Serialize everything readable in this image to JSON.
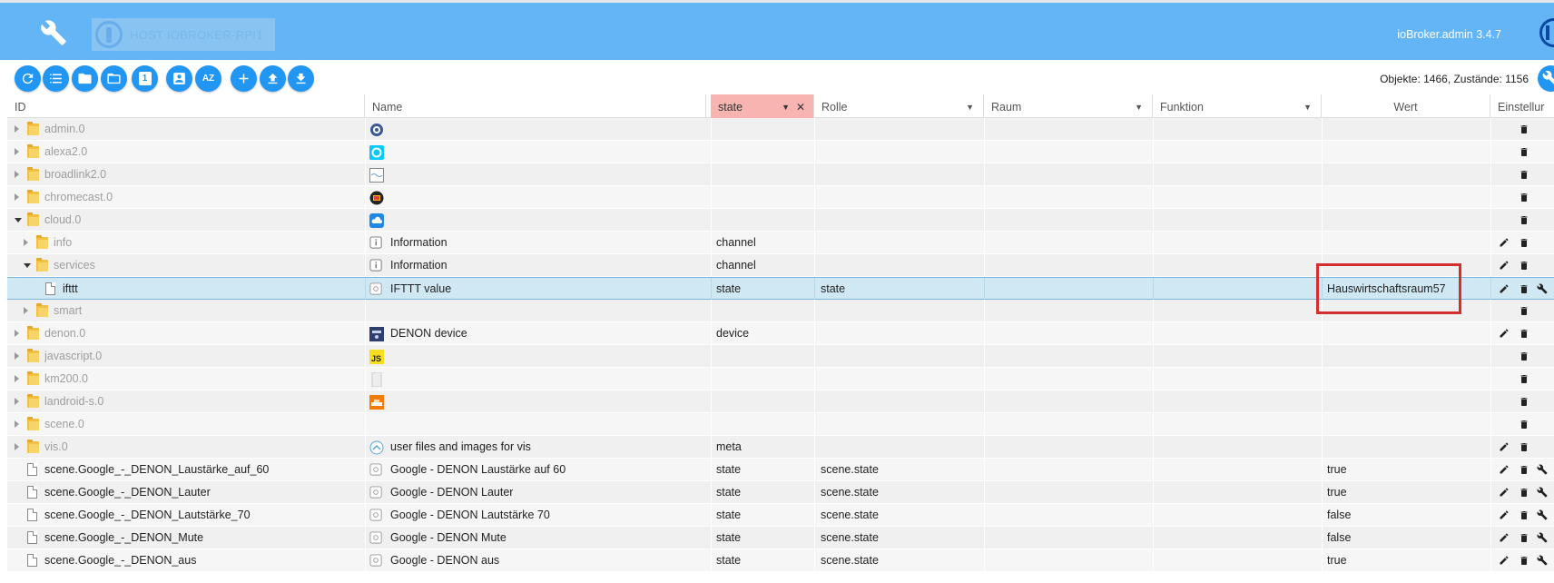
{
  "header": {
    "host_label": "HOST IOBROKER-RPI1",
    "version": "ioBroker.admin 3.4.7",
    "brand_color": "#64b5f6"
  },
  "toolbar": {
    "buttons": [
      "refresh-icon",
      "list-icon",
      "folder-icon",
      "folder-open-icon",
      "number-one-icon",
      "person-icon",
      "sort-az-icon",
      "plus-icon",
      "upload-icon",
      "download-icon"
    ],
    "sort_label": "AZ",
    "num_label": "1",
    "counts": "Objekte: 1466, Zustände: 1156"
  },
  "columns": {
    "id": "ID",
    "name": "Name",
    "type": "state",
    "role": "Rolle",
    "room": "Raum",
    "function": "Funktion",
    "value": "Wert",
    "settings": "Einstellur"
  },
  "rows": [
    {
      "id": "admin.0",
      "indent": 0,
      "kind": "folder",
      "expand": "collapsed",
      "icon": "admin-icon",
      "name": "",
      "type": "",
      "role": "",
      "value": "",
      "actions": [
        "delete"
      ]
    },
    {
      "id": "alexa2.0",
      "indent": 0,
      "kind": "folder",
      "expand": "collapsed",
      "icon": "alexa-icon",
      "name": "",
      "type": "",
      "role": "",
      "value": "",
      "actions": [
        "delete"
      ]
    },
    {
      "id": "broadlink2.0",
      "indent": 0,
      "kind": "folder",
      "expand": "collapsed",
      "icon": "broadlink-icon",
      "name": "",
      "type": "",
      "role": "",
      "value": "",
      "actions": [
        "delete"
      ]
    },
    {
      "id": "chromecast.0",
      "indent": 0,
      "kind": "folder",
      "expand": "collapsed",
      "icon": "chromecast-icon",
      "name": "",
      "type": "",
      "role": "",
      "value": "",
      "actions": [
        "delete"
      ]
    },
    {
      "id": "cloud.0",
      "indent": 0,
      "kind": "folder",
      "expand": "expanded",
      "icon": "cloud-icon",
      "name": "",
      "type": "",
      "role": "",
      "value": "",
      "actions": [
        "delete"
      ]
    },
    {
      "id": "info",
      "indent": 1,
      "kind": "folder",
      "expand": "collapsed",
      "icon": "info-icon",
      "name": "Information",
      "type": "channel",
      "role": "",
      "value": "",
      "actions": [
        "edit",
        "delete"
      ]
    },
    {
      "id": "services",
      "indent": 1,
      "kind": "folder",
      "expand": "expanded",
      "icon": "info-icon",
      "name": "Information",
      "type": "channel",
      "role": "",
      "value": "",
      "actions": [
        "edit",
        "delete"
      ]
    },
    {
      "id": "ifttt",
      "indent": 2,
      "kind": "file",
      "expand": "none",
      "icon": "state-icon",
      "name": "IFTTT value",
      "type": "state",
      "role": "state",
      "value": "Hauswirtschaftsraum57",
      "actions": [
        "edit",
        "delete",
        "wrench"
      ],
      "selected": true
    },
    {
      "id": "smart",
      "indent": 1,
      "kind": "folder",
      "expand": "collapsed",
      "icon": "",
      "name": "",
      "type": "",
      "role": "",
      "value": "",
      "actions": [
        "delete"
      ]
    },
    {
      "id": "denon.0",
      "indent": 0,
      "kind": "folder",
      "expand": "collapsed",
      "icon": "denon-icon",
      "name": "DENON device",
      "type": "device",
      "role": "",
      "value": "",
      "actions": [
        "edit",
        "delete"
      ]
    },
    {
      "id": "javascript.0",
      "indent": 0,
      "kind": "folder",
      "expand": "collapsed",
      "icon": "js-icon",
      "name": "",
      "type": "",
      "role": "",
      "value": "",
      "actions": [
        "delete"
      ]
    },
    {
      "id": "km200.0",
      "indent": 0,
      "kind": "folder",
      "expand": "collapsed",
      "icon": "km200-icon",
      "name": "",
      "type": "",
      "role": "",
      "value": "",
      "actions": [
        "delete"
      ]
    },
    {
      "id": "landroid-s.0",
      "indent": 0,
      "kind": "folder",
      "expand": "collapsed",
      "icon": "landroid-icon",
      "name": "",
      "type": "",
      "role": "",
      "value": "",
      "actions": [
        "delete"
      ]
    },
    {
      "id": "scene.0",
      "indent": 0,
      "kind": "folder",
      "expand": "collapsed",
      "icon": "",
      "name": "",
      "type": "",
      "role": "",
      "value": "",
      "actions": [
        "delete"
      ]
    },
    {
      "id": "vis.0",
      "indent": 0,
      "kind": "folder",
      "expand": "collapsed",
      "icon": "vis-icon",
      "name": "user files and images for vis",
      "type": "meta",
      "role": "",
      "value": "",
      "actions": [
        "edit",
        "delete"
      ]
    },
    {
      "id": "scene.Google_-_DENON_Laustärke_auf_60",
      "indent": 0,
      "kind": "file",
      "expand": "none",
      "icon": "state-icon",
      "name": "Google - DENON Laustärke auf 60",
      "type": "state",
      "role": "scene.state",
      "value": "true",
      "actions": [
        "edit",
        "delete",
        "wrench"
      ]
    },
    {
      "id": "scene.Google_-_DENON_Lauter",
      "indent": 0,
      "kind": "file",
      "expand": "none",
      "icon": "state-icon",
      "name": "Google - DENON Lauter",
      "type": "state",
      "role": "scene.state",
      "value": "true",
      "actions": [
        "edit",
        "delete",
        "wrench"
      ]
    },
    {
      "id": "scene.Google_-_DENON_Lautstärke_70",
      "indent": 0,
      "kind": "file",
      "expand": "none",
      "icon": "state-icon",
      "name": "Google - DENON Lautstärke 70",
      "type": "state",
      "role": "scene.state",
      "value": "false",
      "actions": [
        "edit",
        "delete",
        "wrench"
      ]
    },
    {
      "id": "scene.Google_-_DENON_Mute",
      "indent": 0,
      "kind": "file",
      "expand": "none",
      "icon": "state-icon",
      "name": "Google - DENON Mute",
      "type": "state",
      "role": "scene.state",
      "value": "false",
      "actions": [
        "edit",
        "delete",
        "wrench"
      ]
    },
    {
      "id": "scene.Google_-_DENON_aus",
      "indent": 0,
      "kind": "file",
      "expand": "none",
      "icon": "state-icon",
      "name": "Google - DENON aus",
      "type": "state",
      "role": "scene.state",
      "value": "true",
      "actions": [
        "edit",
        "delete",
        "wrench"
      ]
    }
  ]
}
